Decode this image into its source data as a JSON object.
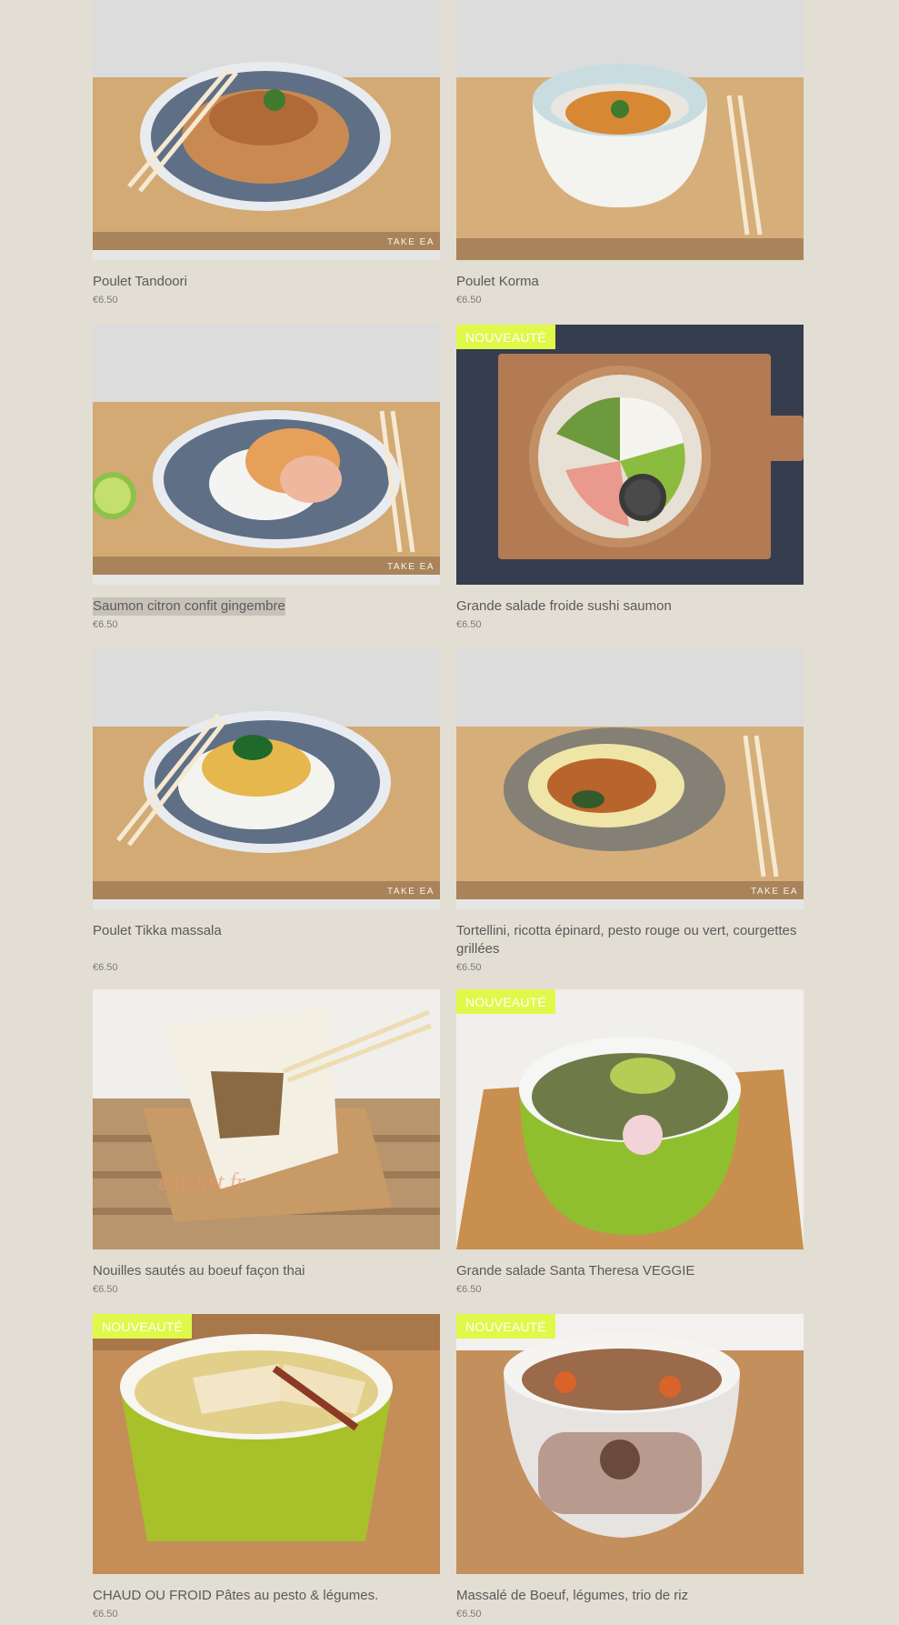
{
  "products": [
    {
      "title": "Poulet Tandoori",
      "price": "€6.50",
      "badge": "",
      "watermark": "TAKE EA"
    },
    {
      "title": "Poulet Korma",
      "price": "€6.50",
      "badge": "",
      "watermark": ""
    },
    {
      "title": "Saumon citron confit gingembre",
      "price": "€6.50",
      "badge": "",
      "watermark": "TAKE EA"
    },
    {
      "title": "Grande salade froide sushi saumon",
      "price": "€6.50",
      "badge": "NOUVEAUTÉ",
      "watermark": ""
    },
    {
      "title": "Poulet Tikka massala",
      "price": "€6.50",
      "badge": "",
      "watermark": "TAKE EA"
    },
    {
      "title": "Tortellini, ricotta épinard, pesto rouge ou vert, courgettes grillées",
      "price": "€6.50",
      "badge": "",
      "watermark": "TAKE EA"
    },
    {
      "title": "Nouilles sautés au boeuf façon thai",
      "price": "€6.50",
      "badge": "",
      "watermark": ""
    },
    {
      "title": "Grande salade Santa Theresa VEGGIE",
      "price": "€6.50",
      "badge": "NOUVEAUTÉ",
      "watermark": ""
    },
    {
      "title": "CHAUD OU FROID Pâtes au pesto & légumes.",
      "price": "€6.50",
      "badge": "NOUVEAUTÉ",
      "watermark": ""
    },
    {
      "title": "Massalé de Boeuf, légumes, trio de riz",
      "price": "€6.50",
      "badge": "NOUVEAUTÉ",
      "watermark": ""
    }
  ]
}
